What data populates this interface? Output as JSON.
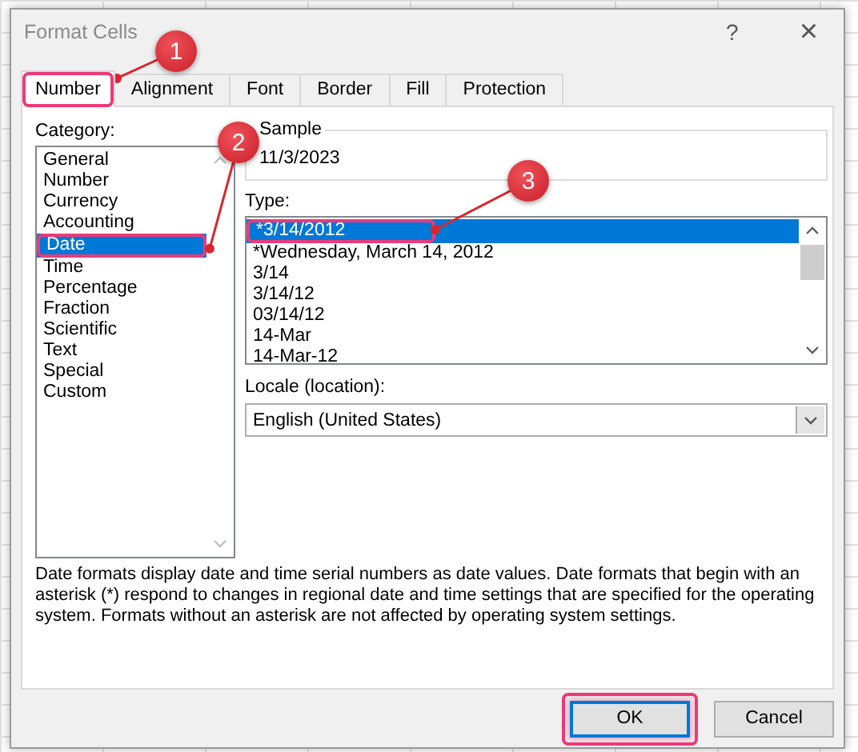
{
  "window": {
    "title": "Format Cells",
    "help": "?",
    "close": "×"
  },
  "tabs": [
    {
      "label": "Number",
      "selected": true,
      "highlighted": true
    },
    {
      "label": "Alignment",
      "selected": false,
      "highlighted": false
    },
    {
      "label": "Font",
      "selected": false,
      "highlighted": false
    },
    {
      "label": "Border",
      "selected": false,
      "highlighted": false
    },
    {
      "label": "Fill",
      "selected": false,
      "highlighted": false
    },
    {
      "label": "Protection",
      "selected": false,
      "highlighted": false
    }
  ],
  "category": {
    "label": "Category:",
    "items": [
      {
        "label": "General",
        "selected": false,
        "highlighted": false
      },
      {
        "label": "Number",
        "selected": false,
        "highlighted": false
      },
      {
        "label": "Currency",
        "selected": false,
        "highlighted": false
      },
      {
        "label": "Accounting",
        "selected": false,
        "highlighted": false
      },
      {
        "label": "Date",
        "selected": true,
        "highlighted": true
      },
      {
        "label": "Time",
        "selected": false,
        "highlighted": false
      },
      {
        "label": "Percentage",
        "selected": false,
        "highlighted": false
      },
      {
        "label": "Fraction",
        "selected": false,
        "highlighted": false
      },
      {
        "label": "Scientific",
        "selected": false,
        "highlighted": false
      },
      {
        "label": "Text",
        "selected": false,
        "highlighted": false
      },
      {
        "label": "Special",
        "selected": false,
        "highlighted": false
      },
      {
        "label": "Custom",
        "selected": false,
        "highlighted": false
      }
    ]
  },
  "sample": {
    "label": "Sample",
    "value": "11/3/2023"
  },
  "type": {
    "label": "Type:",
    "items": [
      {
        "label": "*3/14/2012",
        "selected": true,
        "highlighted": true
      },
      {
        "label": "*Wednesday, March 14, 2012",
        "selected": false,
        "highlighted": false
      },
      {
        "label": "3/14",
        "selected": false,
        "highlighted": false
      },
      {
        "label": "3/14/12",
        "selected": false,
        "highlighted": false
      },
      {
        "label": "03/14/12",
        "selected": false,
        "highlighted": false
      },
      {
        "label": "14-Mar",
        "selected": false,
        "highlighted": false
      },
      {
        "label": "14-Mar-12",
        "selected": false,
        "highlighted": false
      }
    ]
  },
  "locale": {
    "label": "Locale (location):",
    "value": "English (United States)"
  },
  "description": "Date formats display date and time serial numbers as date values.  Date formats that begin with an asterisk (*) respond to changes in regional date and time settings that are specified for the operating system. Formats without an asterisk are not affected by operating system settings.",
  "buttons": [
    {
      "label": "OK",
      "default": true,
      "highlighted": true
    },
    {
      "label": "Cancel",
      "default": false,
      "highlighted": false
    }
  ],
  "annotations": [
    {
      "label": "1"
    },
    {
      "label": "2"
    },
    {
      "label": "3"
    }
  ]
}
